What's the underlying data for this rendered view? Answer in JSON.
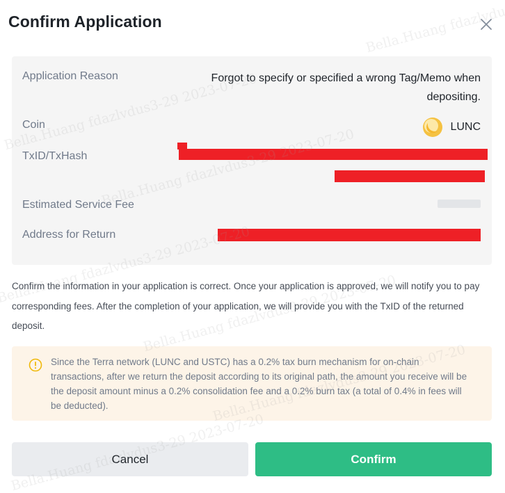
{
  "dialog": {
    "title": "Confirm Application"
  },
  "details": {
    "reason_label": "Application Reason",
    "reason_value": "Forgot to specify or specified a wrong Tag/Memo when depositing.",
    "coin_label": "Coin",
    "coin_value": "LUNC",
    "txid_label": "TxID/TxHash",
    "fee_label": "Estimated Service Fee",
    "return_address_label": "Address for Return"
  },
  "info_text": "Confirm the information in your application is correct. Once your application is approved, we will notify you to pay corresponding fees. After the completion of your application, we will provide you with the TxID of the returned deposit.",
  "warning_text": "Since the Terra network (LUNC and USTC) has a 0.2% tax burn mechanism for on-chain transactions, after we return the deposit according to its original path, the amount you receive will be the deposit amount minus a 0.2% consolidation fee and a 0.2% burn tax (a total of 0.4% in fees will be deducted).",
  "buttons": {
    "cancel": "Cancel",
    "confirm": "Confirm"
  },
  "watermark_text": "Bella.Huang fdazlvdus3-29 2023-07-20",
  "colors": {
    "confirm_button": "#2ebd85",
    "cancel_button": "#eaecef",
    "panel_background": "#f5f5f5",
    "warning_background": "#fdf4e8",
    "warning_icon": "#f0b90b",
    "redaction": "#ee2026"
  },
  "icons": {
    "close": "close-icon",
    "coin": "lunc-coin-icon",
    "warning": "warning-circle-icon"
  }
}
